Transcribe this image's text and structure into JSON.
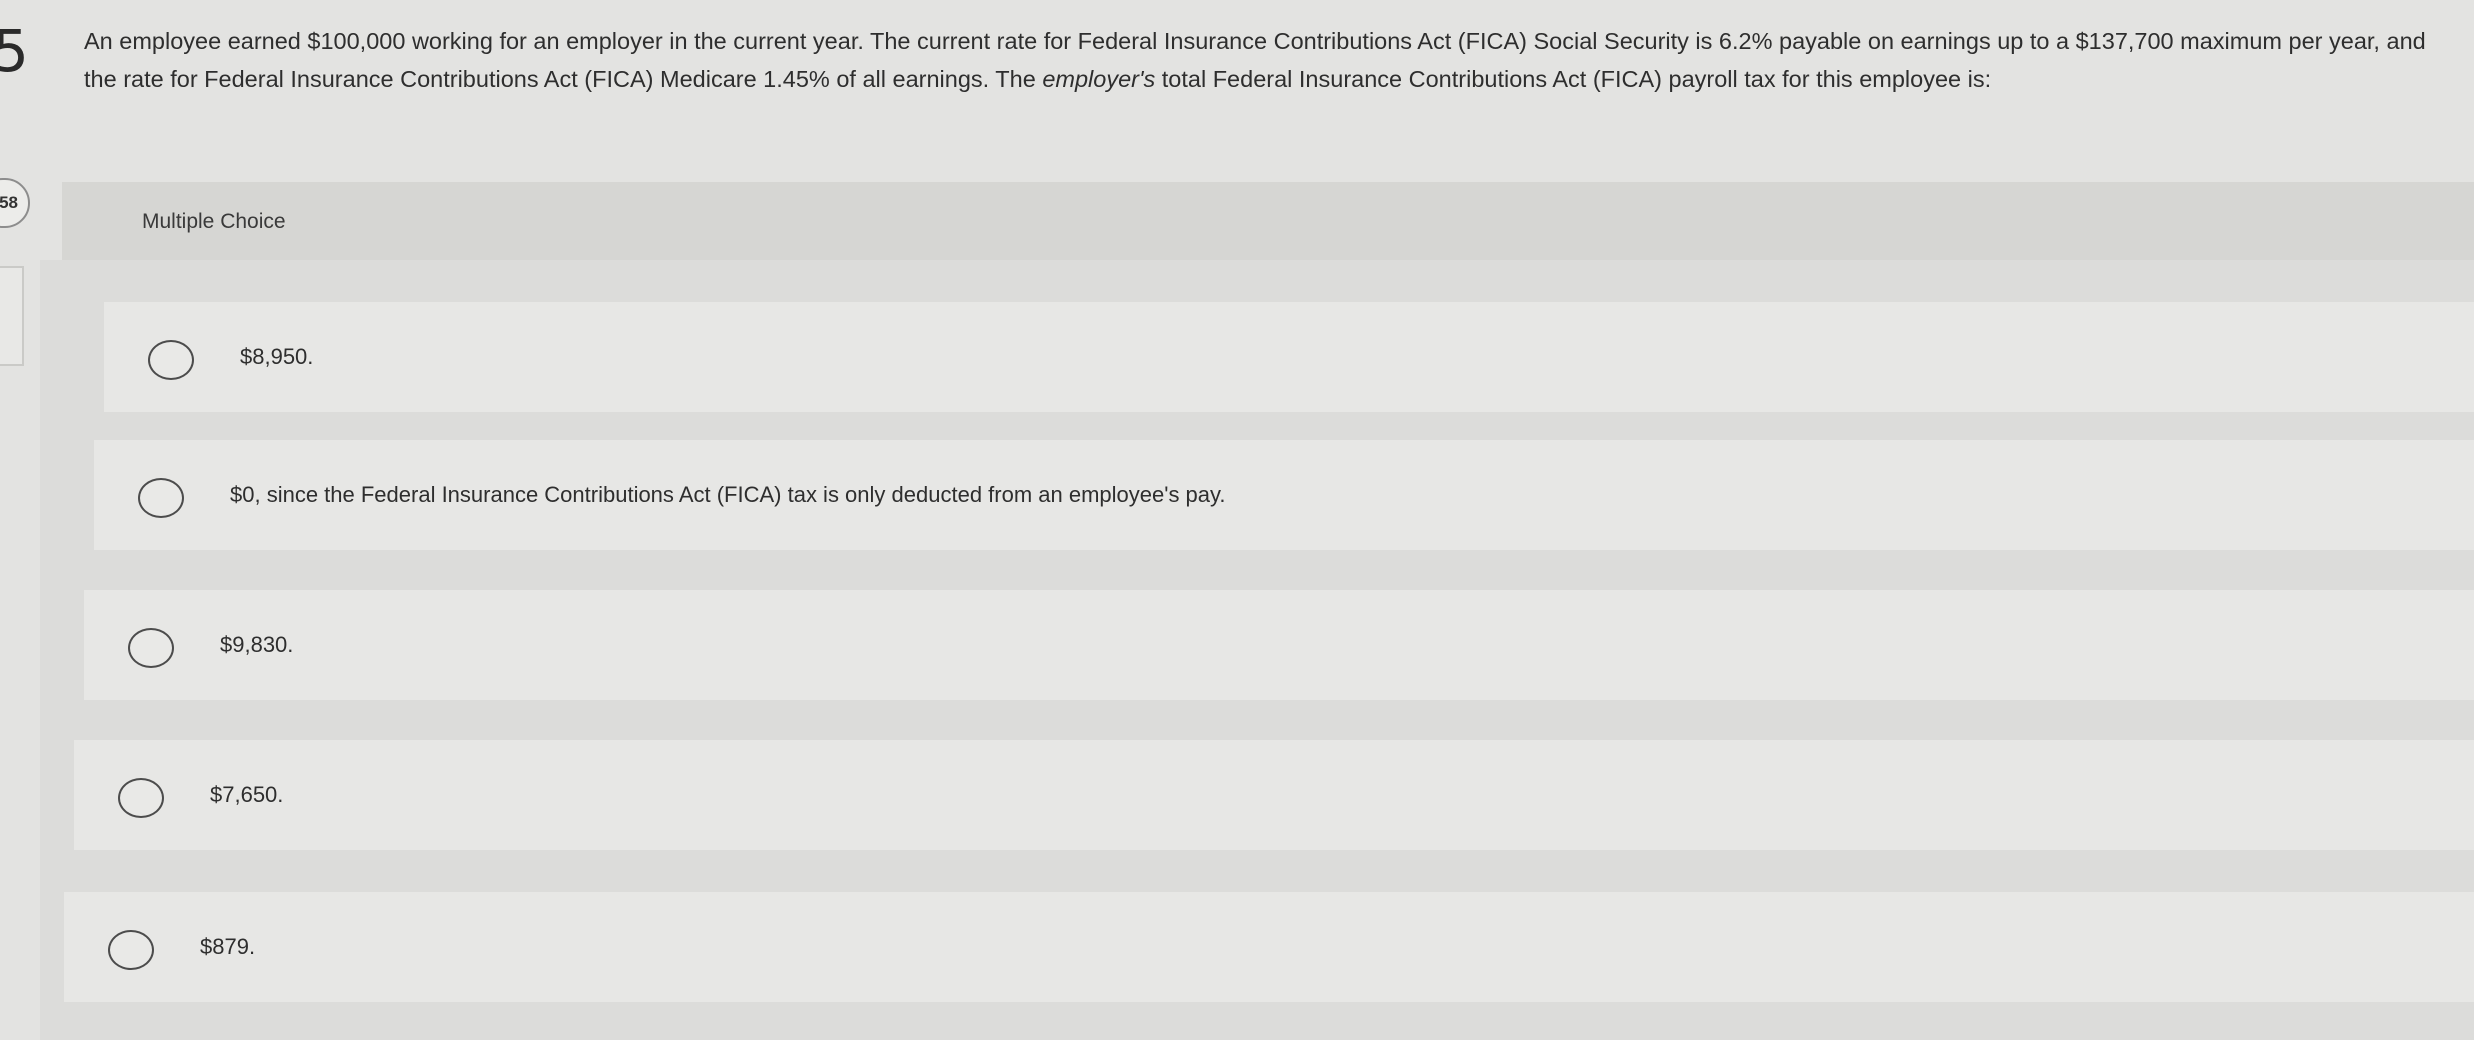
{
  "question": {
    "number": "5",
    "id_badge": "58",
    "text_before_emphasis": "An employee earned $100,000 working for an employer in the current year. The current rate for Federal Insurance Contributions Act (FICA) Social Security is 6.2% payable on earnings up to a $137,700 maximum per year, and the rate for Federal Insurance Contributions Act (FICA) Medicare 1.45% of all earnings. The ",
    "text_emphasis": "employer's",
    "text_after_emphasis": " total Federal Insurance Contributions Act (FICA) payroll tax for this employee is:"
  },
  "choices": {
    "heading": "Multiple Choice",
    "options": [
      {
        "label": "$8,950."
      },
      {
        "label": "$0, since the Federal Insurance Contributions Act (FICA) tax is only deducted from an employee's pay."
      },
      {
        "label": "$9,830."
      },
      {
        "label": "$7,650."
      },
      {
        "label": "$879."
      }
    ]
  }
}
